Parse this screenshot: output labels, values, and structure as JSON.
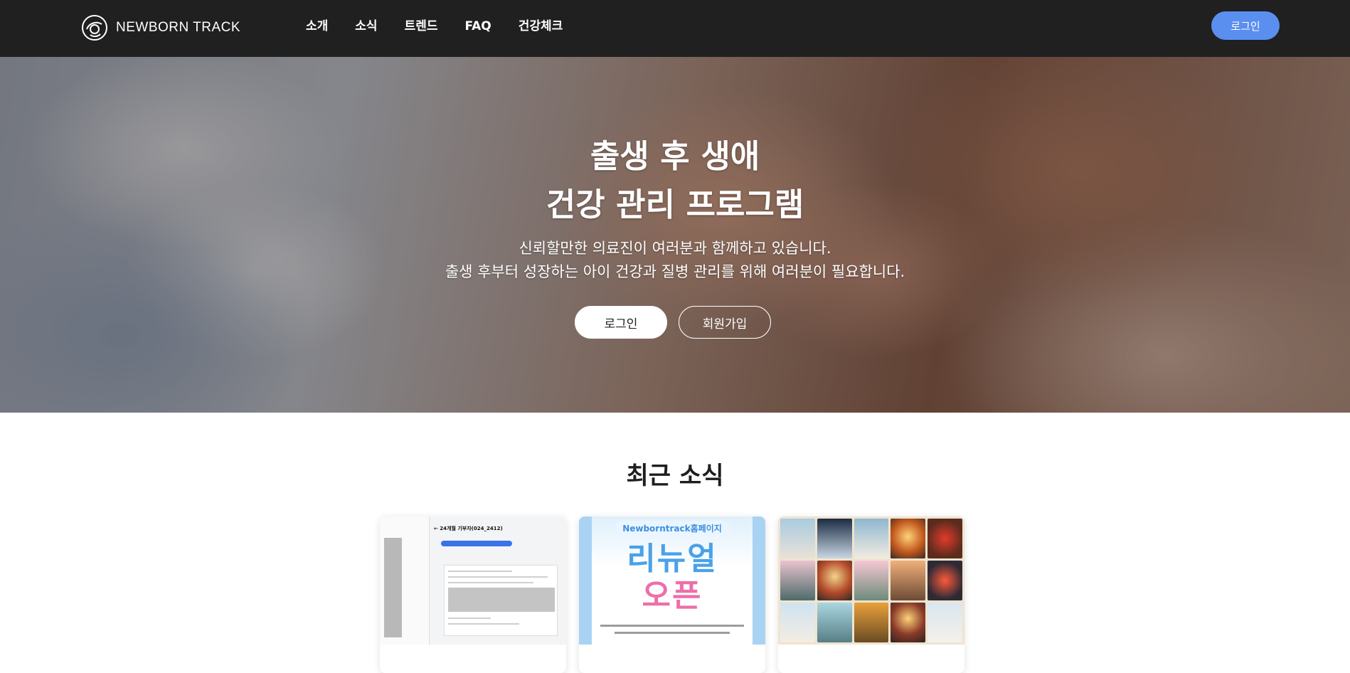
{
  "brand": {
    "name": "NEWBORN TRACK",
    "logo_icon": "baby-logo-icon"
  },
  "nav": {
    "items": [
      {
        "label": "소개"
      },
      {
        "label": "소식"
      },
      {
        "label": "트렌드"
      },
      {
        "label": "FAQ"
      },
      {
        "label": "건강체크"
      }
    ],
    "login_label": "로그인"
  },
  "hero": {
    "title_line1": "출생 후 생애",
    "title_line2": "건강 관리 프로그램",
    "subtitle_line1": "신뢰할만한 의료진이 여러분과 함께하고 있습니다.",
    "subtitle_line2": "출생 후부터 성장하는 아이 건강과 질병 관리를 위해 여러분이 필요합니다.",
    "login_label": "로그인",
    "signup_label": "회원가입"
  },
  "news": {
    "section_title": "최근 소식",
    "cards": [
      {
        "thumb_caption": "← 24개월 기부자(024_2412)"
      },
      {
        "thumb_tag": "Newborntrack홈페이지",
        "thumb_line1": "리뉴얼",
        "thumb_line2": "오픈"
      },
      {
        "thumb_type": "collage"
      }
    ]
  },
  "colors": {
    "navbar": "#202020",
    "accent": "#5a8ff0",
    "renewal_blue": "#4aa1e8",
    "renewal_pink": "#ee6fa9"
  }
}
